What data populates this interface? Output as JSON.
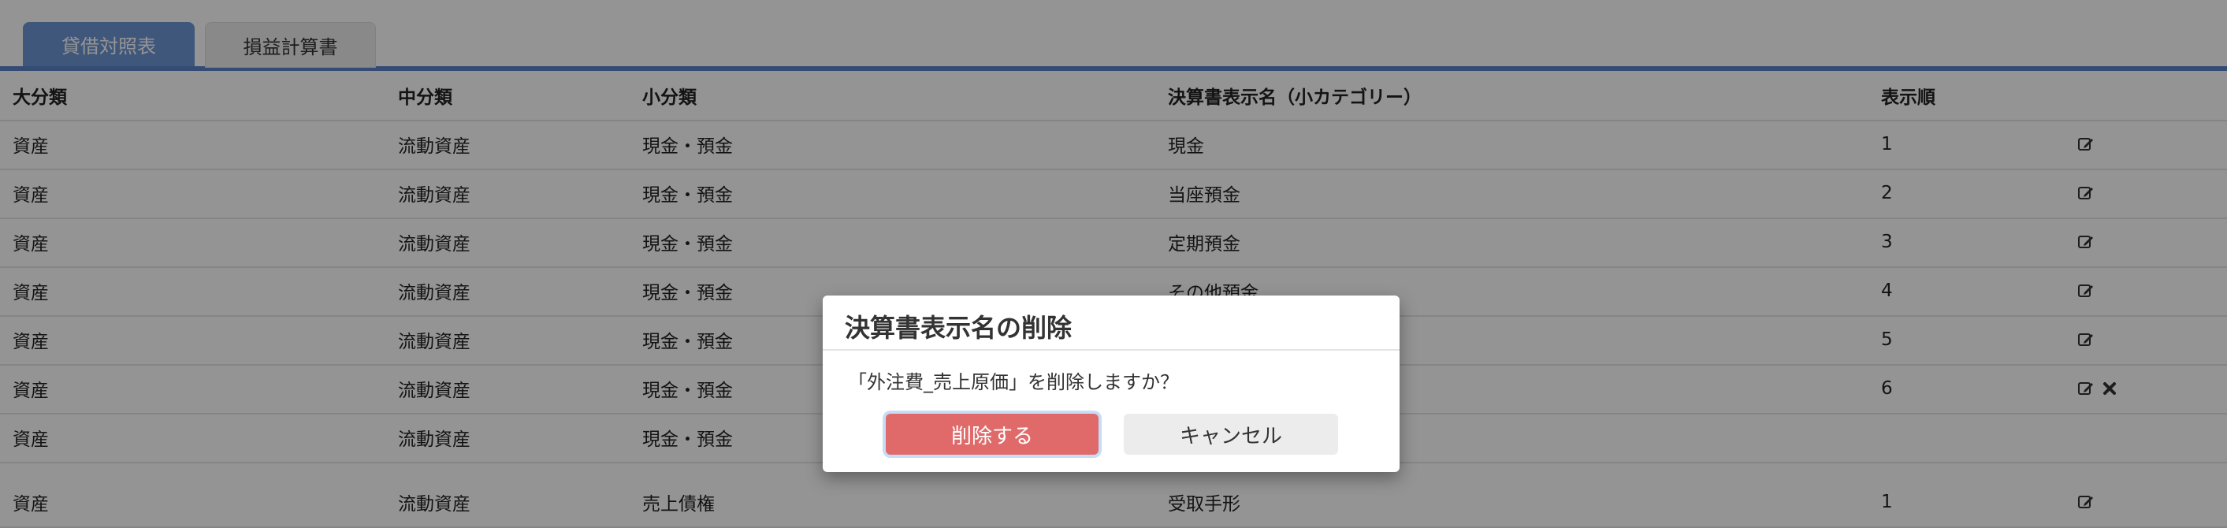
{
  "tabs": [
    {
      "label": "貸借対照表",
      "active": true
    },
    {
      "label": "損益計算書",
      "active": false
    }
  ],
  "table": {
    "headers": [
      "大分類",
      "中分類",
      "小分類",
      "決算書表示名（小カテゴリー）",
      "表示順"
    ],
    "rows": [
      {
        "c0": "資産",
        "c1": "流動資産",
        "c2": "現金・預金",
        "c3": "現金",
        "c4": "1",
        "edit": true,
        "delete": false
      },
      {
        "c0": "資産",
        "c1": "流動資産",
        "c2": "現金・預金",
        "c3": "当座預金",
        "c4": "2",
        "edit": true,
        "delete": false
      },
      {
        "c0": "資産",
        "c1": "流動資産",
        "c2": "現金・預金",
        "c3": "定期預金",
        "c4": "3",
        "edit": true,
        "delete": false
      },
      {
        "c0": "資産",
        "c1": "流動資産",
        "c2": "現金・預金",
        "c3": "その他預金",
        "c4": "4",
        "edit": true,
        "delete": false
      },
      {
        "c0": "資産",
        "c1": "流動資産",
        "c2": "現金・預金",
        "c3": "",
        "c4": "5",
        "edit": true,
        "delete": false
      },
      {
        "c0": "資産",
        "c1": "流動資産",
        "c2": "現金・預金",
        "c3": "",
        "c4": "6",
        "edit": true,
        "delete": true
      },
      {
        "c0": "資産",
        "c1": "流動資産",
        "c2": "現金・預金",
        "c3": "",
        "c4": "",
        "edit": false,
        "delete": false
      },
      {
        "c0": "資産",
        "c1": "流動資産",
        "c2": "売上債権",
        "c3": "受取手形",
        "c4": "1",
        "edit": true,
        "delete": false
      }
    ]
  },
  "modal": {
    "title": "決算書表示名の削除",
    "message": "「外注費_売上原価」を削除しますか？",
    "confirm_label": "削除する",
    "cancel_label": "キャンセル"
  },
  "icons": {
    "edit": "edit-icon",
    "delete": "delete-icon"
  },
  "colors": {
    "accent": "#5b83c9",
    "danger": "#e06a6a"
  }
}
